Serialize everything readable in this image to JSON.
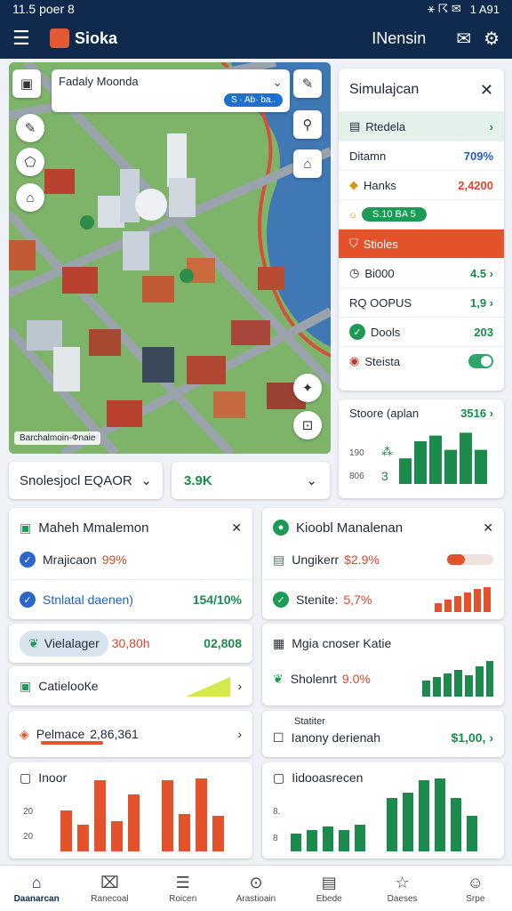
{
  "status": {
    "time": "11.5 poer 8",
    "icons": "⚹ ☈ ✉",
    "right": "1 A91"
  },
  "appbar": {
    "title": "Sioka",
    "user": "INensin"
  },
  "map": {
    "search_title": "Fadaly  Moonda",
    "search_pill": "S · Ab· ba..",
    "caption": "Barchalmoin-Фnaie"
  },
  "simulation": {
    "title": "Simulajcan",
    "rows": [
      {
        "label": "Rtedela",
        "value": "›",
        "kind": "sel"
      },
      {
        "label": "Ditamn",
        "value": "709%",
        "kind": "blue"
      },
      {
        "label": "Hanks",
        "value": "2,4200",
        "kind": "red"
      },
      {
        "label": "S.10 BA 5",
        "value": "",
        "kind": "pill"
      },
      {
        "label": "Stioles",
        "value": "",
        "kind": "hot"
      },
      {
        "label": "Bi000",
        "value": "4.5 ›",
        "kind": "green"
      },
      {
        "label": "RQ OOPUS",
        "value": "1,9 ›",
        "kind": "green"
      },
      {
        "label": "Dools",
        "value": "203",
        "kind": "green"
      },
      {
        "label": "Steista",
        "value": "",
        "kind": "toggle"
      }
    ]
  },
  "store": {
    "title": "Stoore (aplan",
    "value": "3516 ›",
    "ticks": [
      "190",
      "806"
    ],
    "bars": [
      0.45,
      0.75,
      0.85,
      0.6,
      0.9,
      0.6
    ]
  },
  "dropdown1": {
    "label": "Snolesjocl EQAOR"
  },
  "dropdown2": {
    "label": "3.9K"
  },
  "left_panel": {
    "title": "Maheh Mmalemon",
    "sub_label": "Mrajicaon",
    "sub_value": "99%",
    "row1_label": "Stnlatal daenen)",
    "row1_value": "154/10%",
    "row2_label": "Vielalager",
    "row2_mid": "30,80h",
    "row2_value": "02,808",
    "row3_label": "CatielooКe",
    "row4_label": "Pelmace",
    "row4_value": "2,86,361",
    "chart_title": "Inoor",
    "chart_ticks": [
      "20",
      "20"
    ]
  },
  "right_panel": {
    "title": "Kioobl Manalenan",
    "sub_label": "Ungikerr",
    "sub_value": "$2.9%",
    "row1_label": "Stenite:",
    "row1_value": "5,7%",
    "row2_label": "Mgia cnoser Katie",
    "row3_label": "Sholenrt",
    "row3_value": "9.0%",
    "row4_kicker": "Statiter",
    "row4_label": "Ianony derienah",
    "row4_value": "$1,00, ›",
    "chart_title": "Iidooasrecen",
    "chart_ticks": [
      "8.",
      "8"
    ]
  },
  "nav": [
    {
      "label": "Daanarcan",
      "icon": "⌂"
    },
    {
      "label": "Ranecoal",
      "icon": "⌧"
    },
    {
      "label": "Roicen",
      "icon": "☰"
    },
    {
      "label": "Arastioain",
      "icon": "⊙"
    },
    {
      "label": "Ebede",
      "icon": "▤"
    },
    {
      "label": "Daeses",
      "icon": "☆"
    },
    {
      "label": "Srpe",
      "icon": "☺"
    }
  ],
  "colors": {
    "brand": "#0f2a4d",
    "accent_red": "#e4522b",
    "accent_green": "#1b9b55"
  }
}
